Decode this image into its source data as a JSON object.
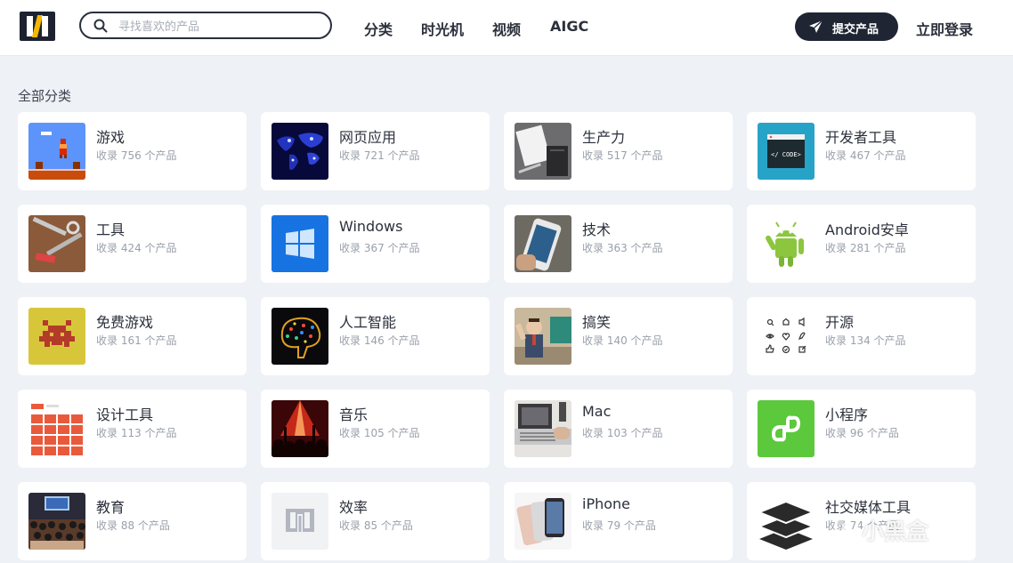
{
  "header": {
    "search_placeholder": "寻找喜欢的产品",
    "nav": [
      "分类",
      "时光机",
      "视频",
      "AIGC"
    ],
    "submit_label": "提交产品",
    "login_label": "立即登录"
  },
  "section_title": "全部分类",
  "categories": [
    {
      "name": "游戏",
      "count": "收录 756 个产品",
      "icon": "mario-pixel-thumb"
    },
    {
      "name": "网页应用",
      "count": "收录 721 个产品",
      "icon": "world-map-lights-thumb"
    },
    {
      "name": "生产力",
      "count": "收录 517 个产品",
      "icon": "desk-notebook-thumb"
    },
    {
      "name": "开发者工具",
      "count": "收录 467 个产品",
      "icon": "code-window-thumb"
    },
    {
      "name": "工具",
      "count": "收录 424 个产品",
      "icon": "tools-thumb"
    },
    {
      "name": "Windows",
      "count": "收录 367 个产品",
      "icon": "windows-logo-thumb"
    },
    {
      "name": "技术",
      "count": "收录 363 个产品",
      "icon": "smartphone-hand-thumb"
    },
    {
      "name": "Android安卓",
      "count": "收录 281 个产品",
      "icon": "android-robot-thumb"
    },
    {
      "name": "免费游戏",
      "count": "收录 161 个产品",
      "icon": "space-invader-thumb"
    },
    {
      "name": "人工智能",
      "count": "收录 146 个产品",
      "icon": "ai-brain-thumb"
    },
    {
      "name": "搞笑",
      "count": "收录 140 个产品",
      "icon": "cartoon-man-thumb"
    },
    {
      "name": "开源",
      "count": "收录 134 个产品",
      "icon": "icon-grid-thumb"
    },
    {
      "name": "设计工具",
      "count": "收录 113 个产品",
      "icon": "color-palette-thumb"
    },
    {
      "name": "音乐",
      "count": "收录 105 个产品",
      "icon": "concert-crowd-thumb"
    },
    {
      "name": "Mac",
      "count": "收录 103 个产品",
      "icon": "laptop-typing-thumb"
    },
    {
      "name": "小程序",
      "count": "收录 96 个产品",
      "icon": "mini-program-thumb"
    },
    {
      "name": "教育",
      "count": "收录 88 个产品",
      "icon": "lecture-hall-thumb"
    },
    {
      "name": "效率",
      "count": "收录 85 个产品",
      "icon": "site-logo-gray-thumb"
    },
    {
      "name": "iPhone",
      "count": "收录 79 个产品",
      "icon": "iphones-thumb"
    },
    {
      "name": "社交媒体工具",
      "count": "收录 74 个产品",
      "icon": "layers-stack-thumb"
    }
  ],
  "watermark": "小黑盒",
  "colors": {
    "accent": "#1f2533",
    "page_bg": "#eef1f5",
    "brand_yellow": "#f5b800"
  }
}
